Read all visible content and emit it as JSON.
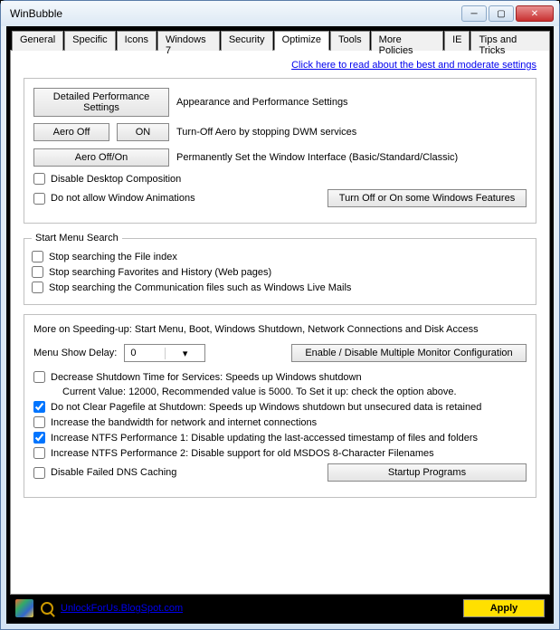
{
  "window": {
    "title": "WinBubble"
  },
  "tabs": [
    "General",
    "Specific",
    "Icons",
    "Windows 7",
    "Security",
    "Optimize",
    "Tools",
    "More Policies",
    "IE",
    "Tips and Tricks"
  ],
  "active_tab": "Optimize",
  "top_link": "Click here to read about the best and moderate settings",
  "group1": {
    "btn_detailed": "Detailed Performance Settings",
    "lbl_detailed": "Appearance and Performance Settings",
    "btn_aero_off": "Aero Off",
    "btn_on": "ON",
    "lbl_aero": "Turn-Off Aero by stopping DWM services",
    "btn_aero_toggle": "Aero Off/On",
    "lbl_perm": "Permanently Set the Window Interface (Basic/Standard/Classic)",
    "chk_disable_comp": "Disable Desktop Composition",
    "chk_no_anim": "Do not allow Window Animations",
    "btn_features": "Turn Off or On  some Windows Features"
  },
  "group2": {
    "legend": "Start Menu Search",
    "chk_file_index": "Stop searching the File index",
    "chk_favorites": "Stop searching Favorites and History (Web pages)",
    "chk_comm": "Stop searching the Communication files such as Windows Live Mails"
  },
  "group3": {
    "heading": "More on Speeding-up: Start Menu, Boot, Windows Shutdown, Network Connections and Disk Access",
    "menu_delay_label": "Menu Show Delay:",
    "menu_delay_value": "0",
    "btn_monitor": "Enable / Disable Multiple Monitor Configuration",
    "chk_shutdown": "Decrease Shutdown Time for Services: Speeds up Windows shutdown",
    "shutdown_sub": "Current Value: 12000, Recommended value is 5000. To Set it up: check the option above.",
    "chk_pagefile": "Do not Clear Pagefile at Shutdown: Speeds up Windows shutdown but unsecured data is retained",
    "chk_bandwidth": "Increase the bandwidth for network and internet connections",
    "chk_ntfs1": "Increase NTFS Performance 1: Disable updating the last-accessed timestamp of files and folders",
    "chk_ntfs2": "Increase NTFS Performance 2: Disable support for old MSDOS 8-Character Filenames",
    "chk_dns": "Disable Failed DNS Caching",
    "btn_startup": "Startup Programs"
  },
  "footer": {
    "link": "UnlockForUs.BlogSpot.com",
    "apply": "Apply"
  },
  "checked": {
    "pagefile": true,
    "ntfs1": true
  }
}
